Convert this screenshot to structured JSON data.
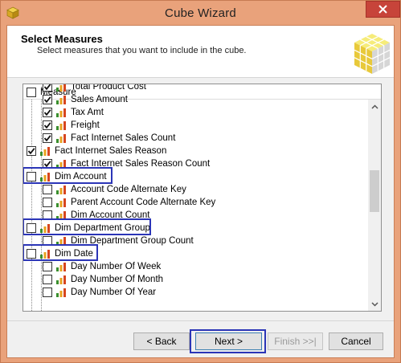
{
  "window": {
    "title": "Cube Wizard",
    "accent": "#e9a27b",
    "close_color": "#c7443a"
  },
  "header": {
    "title": "Select Measures",
    "subtitle": "Select measures that you want to include in the cube."
  },
  "list": {
    "column_header": "Measure",
    "items": [
      {
        "label": "Total Product Cost",
        "checked": true,
        "level": 2
      },
      {
        "label": "Sales Amount",
        "checked": true,
        "level": 2
      },
      {
        "label": "Tax Amt",
        "checked": true,
        "level": 2
      },
      {
        "label": "Freight",
        "checked": true,
        "level": 2
      },
      {
        "label": "Fact Internet Sales Count",
        "checked": true,
        "level": 2
      },
      {
        "label": "Fact Internet Sales Reason",
        "checked": true,
        "level": 1
      },
      {
        "label": "Fact Internet Sales Reason Count",
        "checked": true,
        "level": 2
      },
      {
        "label": "Dim Account",
        "checked": false,
        "level": 1,
        "highlighted": true
      },
      {
        "label": "Account Code Alternate Key",
        "checked": false,
        "level": 2
      },
      {
        "label": "Parent Account Code Alternate Key",
        "checked": false,
        "level": 2
      },
      {
        "label": "Dim Account Count",
        "checked": false,
        "level": 2
      },
      {
        "label": "Dim Department Group",
        "checked": false,
        "level": 1,
        "highlighted": true
      },
      {
        "label": "Dim Department Group Count",
        "checked": false,
        "level": 2
      },
      {
        "label": "Dim Date",
        "checked": false,
        "level": 1,
        "highlighted": true
      },
      {
        "label": "Day Number Of Week",
        "checked": false,
        "level": 2
      },
      {
        "label": "Day Number Of Month",
        "checked": false,
        "level": 2
      },
      {
        "label": "Day Number Of Year",
        "checked": false,
        "level": 2
      }
    ],
    "highlight_color": "#2b35b7"
  },
  "buttons": {
    "back": "< Back",
    "next": "Next >",
    "finish": "Finish >>|",
    "cancel": "Cancel"
  }
}
